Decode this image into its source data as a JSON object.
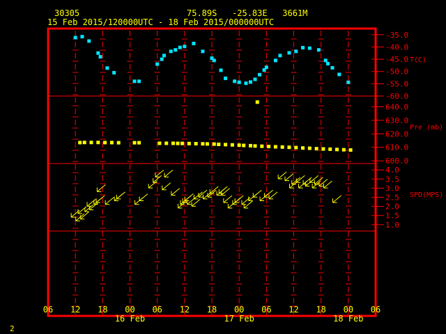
{
  "header": {
    "station": "30305",
    "location": "75.89S   -25.83E   3661M",
    "period": "15 Feb 2015/120000UTC - 18 Feb 2015/000000UTC"
  },
  "footer": {
    "page": "2"
  },
  "colors": {
    "frame": "#ff0000",
    "axis_text": "#ffff00",
    "temp": "#00e5ff",
    "pressure": "#ffff00",
    "wind": "#ffff00",
    "unit_text": "#ff0000",
    "bg": "#000000"
  },
  "x_axis": {
    "tick_labels": [
      "06",
      "12",
      "18",
      "00",
      "06",
      "12",
      "18",
      "00",
      "06",
      "12",
      "18",
      "00",
      "06"
    ],
    "day_labels": [
      {
        "label": "16 Feb",
        "hour": 24
      },
      {
        "label": "17 Feb",
        "hour": 48
      },
      {
        "label": "18 Feb",
        "hour": 72
      }
    ],
    "start_hour": 6,
    "end_hour": 78,
    "tick_step_hours": 6
  },
  "chart_data": [
    {
      "type": "scatter",
      "name": "temperature",
      "ylabel": "T(C)",
      "ylim": [
        -60,
        -32.5
      ],
      "ticks": [
        "-35.0",
        "-40.0",
        "-45.0",
        "-50.0",
        "-55.0",
        "-60.0"
      ],
      "tick_values": [
        -35,
        -40,
        -45,
        -50,
        -55,
        -60
      ],
      "points": [
        [
          12,
          -36.2
        ],
        [
          13.5,
          -35.8
        ],
        [
          15,
          -37.6
        ],
        [
          17,
          -42.5
        ],
        [
          17.5,
          -44
        ],
        [
          19,
          -48.6
        ],
        [
          20.5,
          -50.5
        ],
        [
          25,
          -54
        ],
        [
          26,
          -54
        ],
        [
          30,
          -47
        ],
        [
          31,
          -45
        ],
        [
          31.5,
          -43.5
        ],
        [
          33,
          -41.8
        ],
        [
          34,
          -41.2
        ],
        [
          35,
          -40.2
        ],
        [
          36,
          -39.8
        ],
        [
          38,
          -38.6
        ],
        [
          40,
          -41.8
        ],
        [
          42,
          -44.6
        ],
        [
          42.5,
          -45.5
        ],
        [
          44,
          -49.5
        ],
        [
          45,
          -52.8
        ],
        [
          47,
          -54
        ],
        [
          48,
          -54.4
        ],
        [
          49.5,
          -54.8
        ],
        [
          50.5,
          -54.3
        ],
        [
          51.5,
          -53.2
        ],
        [
          52.5,
          -51.3
        ],
        [
          53.5,
          -49.4
        ],
        [
          54,
          -48.3
        ],
        [
          56,
          -45.5
        ],
        [
          57,
          -43.5
        ],
        [
          59,
          -42.4
        ],
        [
          60.5,
          -41.8
        ],
        [
          62,
          -40.3
        ],
        [
          63.5,
          -40.5
        ],
        [
          65.5,
          -41.2
        ],
        [
          67,
          -45.5
        ],
        [
          67.5,
          -46.8
        ],
        [
          68.5,
          -48.5
        ],
        [
          70,
          -51.2
        ],
        [
          72,
          -54.4
        ]
      ]
    },
    {
      "type": "scatter",
      "name": "pressure",
      "ylabel": "Pre (mb)",
      "ylim": [
        598,
        648
      ],
      "ticks": [
        "640.0",
        "630.0",
        "620.0",
        "610.0",
        "600.0"
      ],
      "tick_values": [
        640,
        630,
        620,
        610,
        600
      ],
      "points": [
        [
          52,
          643.5
        ],
        [
          13,
          613.5
        ],
        [
          14,
          613.6
        ],
        [
          15.5,
          613.6
        ],
        [
          17,
          613.6
        ],
        [
          18.5,
          613.5
        ],
        [
          20,
          613.5
        ],
        [
          21.5,
          613.4
        ],
        [
          25,
          613.4
        ],
        [
          26,
          613.4
        ],
        [
          30.5,
          613
        ],
        [
          32,
          613
        ],
        [
          33.5,
          613
        ],
        [
          34.5,
          612.9
        ],
        [
          35.5,
          612.9
        ],
        [
          37,
          612.8
        ],
        [
          38.5,
          612.7
        ],
        [
          40,
          612.6
        ],
        [
          41,
          612.5
        ],
        [
          42.5,
          612.4
        ],
        [
          43.5,
          612.2
        ],
        [
          45,
          612
        ],
        [
          46.5,
          611.8
        ],
        [
          48,
          611.6
        ],
        [
          49,
          611.4
        ],
        [
          50.5,
          611.2
        ],
        [
          51.5,
          611
        ],
        [
          53,
          610.8
        ],
        [
          54.5,
          610.6
        ],
        [
          56,
          610.4
        ],
        [
          57.5,
          610.2
        ],
        [
          59,
          610
        ],
        [
          60.5,
          609.8
        ],
        [
          62,
          609.5
        ],
        [
          63.5,
          609.3
        ],
        [
          65,
          609
        ],
        [
          66.5,
          608.8
        ],
        [
          68,
          608.6
        ],
        [
          69.5,
          608.4
        ],
        [
          71,
          608.2
        ],
        [
          72.5,
          608
        ]
      ]
    },
    {
      "type": "scatter",
      "name": "wind",
      "ylabel": "SPD(MPS)",
      "ylim": [
        0.65,
        4.35
      ],
      "ticks": [
        "4.0",
        "3.5",
        "3.0",
        "2.5",
        "2.0",
        "1.5",
        "1.0"
      ],
      "tick_values": [
        4,
        3.5,
        3,
        2.5,
        2,
        1.5,
        1
      ],
      "points": [
        [
          12,
          1.6
        ],
        [
          13,
          1.4
        ],
        [
          13.5,
          1.8
        ],
        [
          14,
          1.5
        ],
        [
          15,
          1.9
        ],
        [
          15.5,
          2.2
        ],
        [
          16,
          2
        ],
        [
          17,
          2.3
        ],
        [
          17.5,
          2.4
        ],
        [
          17.7,
          3
        ],
        [
          19.5,
          2.3
        ],
        [
          21.5,
          2.5
        ],
        [
          22,
          2.6
        ],
        [
          26,
          2.3
        ],
        [
          27,
          2.5
        ],
        [
          29,
          3.2
        ],
        [
          30,
          3.5
        ],
        [
          30.5,
          3.8
        ],
        [
          32.5,
          3.8
        ],
        [
          32,
          3.1
        ],
        [
          34,
          2.8
        ],
        [
          35.5,
          2.1
        ],
        [
          36,
          2.3
        ],
        [
          36.5,
          2.4
        ],
        [
          37,
          2.5
        ],
        [
          37.5,
          2.3
        ],
        [
          38.5,
          2.2
        ],
        [
          39,
          2.6
        ],
        [
          40,
          2.7
        ],
        [
          41,
          2.6
        ],
        [
          42,
          2.7
        ],
        [
          42.5,
          2.9
        ],
        [
          44,
          2.8
        ],
        [
          44.5,
          2.9
        ],
        [
          45,
          2.8
        ],
        [
          45.5,
          2.4
        ],
        [
          46.5,
          2.1
        ],
        [
          47.5,
          2.3
        ],
        [
          48,
          2.4
        ],
        [
          49.5,
          2.3
        ],
        [
          50,
          2.1
        ],
        [
          51,
          2.5
        ],
        [
          52,
          2.7
        ],
        [
          53.5,
          2.5
        ],
        [
          54.5,
          2.7
        ],
        [
          55.5,
          2.6
        ],
        [
          57.5,
          3.7
        ],
        [
          59,
          3.6
        ],
        [
          60,
          3.2
        ],
        [
          60.5,
          3.4
        ],
        [
          61.5,
          3.5
        ],
        [
          62,
          3.2
        ],
        [
          63,
          3.4
        ],
        [
          63.5,
          3.3
        ],
        [
          64.5,
          3.5
        ],
        [
          65,
          3.2
        ],
        [
          65.5,
          3.4
        ],
        [
          66.5,
          3.3
        ],
        [
          67.5,
          3.2
        ],
        [
          69.5,
          2.4
        ]
      ]
    }
  ]
}
